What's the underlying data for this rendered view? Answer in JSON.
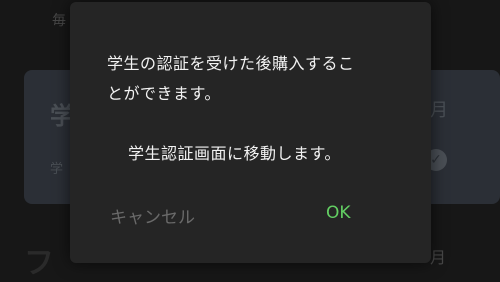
{
  "background": {
    "top_text": "毎",
    "card_title": "学",
    "card_sub": "学",
    "card_right": "月",
    "bottom_left": "フ",
    "bottom_right": "月"
  },
  "dialog": {
    "line1": "学生の認証を受けた後購入するこ",
    "line2": "とができます。",
    "line3": "学生認証画面に移動します。",
    "cancel_label": "キャンセル",
    "ok_label": "OK"
  },
  "colors": {
    "ok": "#63cf63",
    "cancel": "#6a6a6a",
    "dialog_bg": "#252525"
  }
}
